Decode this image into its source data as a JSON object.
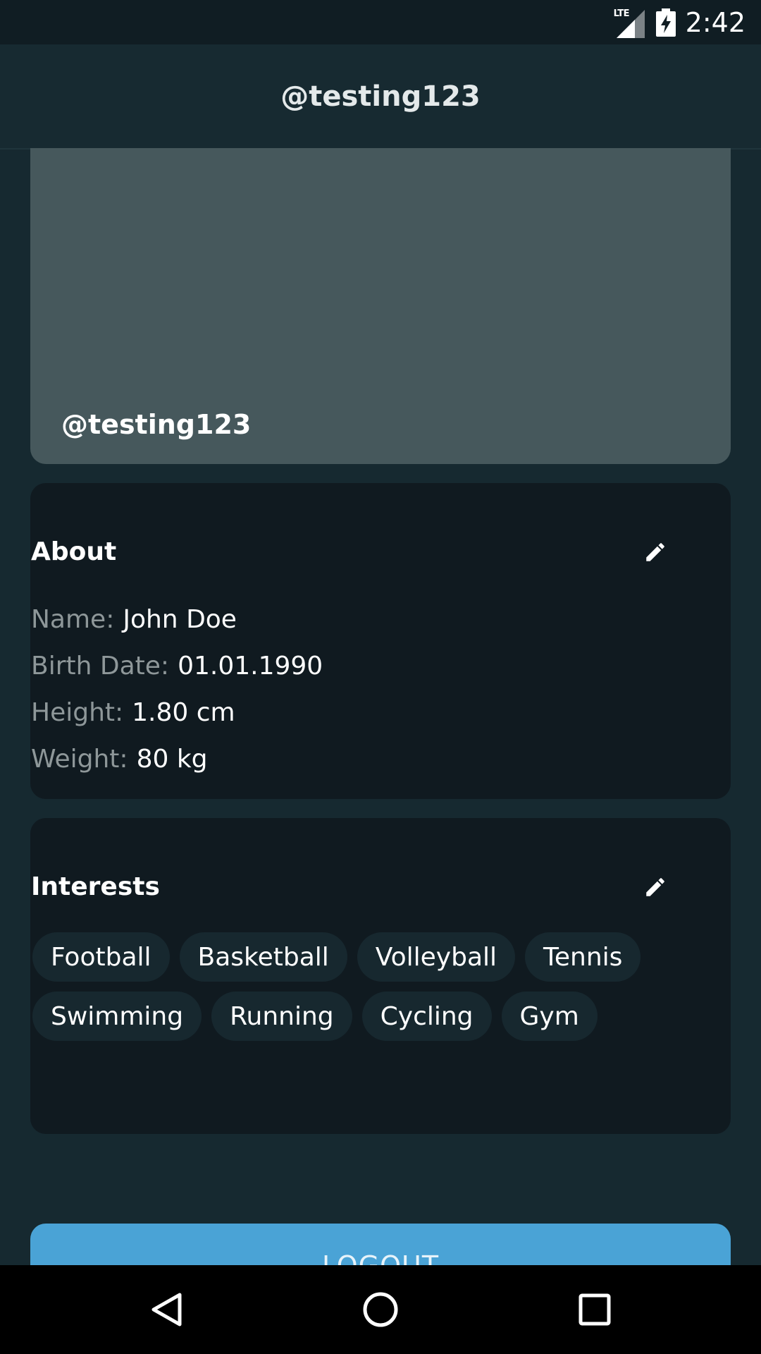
{
  "status_bar": {
    "network_label": "LTE",
    "time": "2:42",
    "icons": [
      "lte-signal-icon",
      "battery-charging-icon"
    ]
  },
  "app_bar": {
    "title": "@testing123"
  },
  "profile_header": {
    "handle": "@testing123",
    "cover_color": "#46585c"
  },
  "about": {
    "title": "About",
    "edit_icon": "pencil-icon",
    "rows": [
      {
        "label": "Name:",
        "value": "John Doe"
      },
      {
        "label": "Birth Date:",
        "value": "01.01.1990"
      },
      {
        "label": "Height:",
        "value": "1.80 cm"
      },
      {
        "label": "Weight:",
        "value": "80 kg"
      }
    ]
  },
  "interests": {
    "title": "Interests",
    "edit_icon": "pencil-icon",
    "items": [
      "Football",
      "Basketball",
      "Volleyball",
      "Tennis",
      "Swimming",
      "Running",
      "Cycling",
      "Gym"
    ]
  },
  "logout": {
    "label": "LOGOUT",
    "color": "#4aa3d6"
  },
  "nav_bar": {
    "icons": [
      "back-icon",
      "home-icon",
      "recents-icon"
    ]
  },
  "colors": {
    "background": "#162930",
    "card": "#101a20",
    "chip": "#17282f",
    "accent": "#4aa3d6"
  }
}
